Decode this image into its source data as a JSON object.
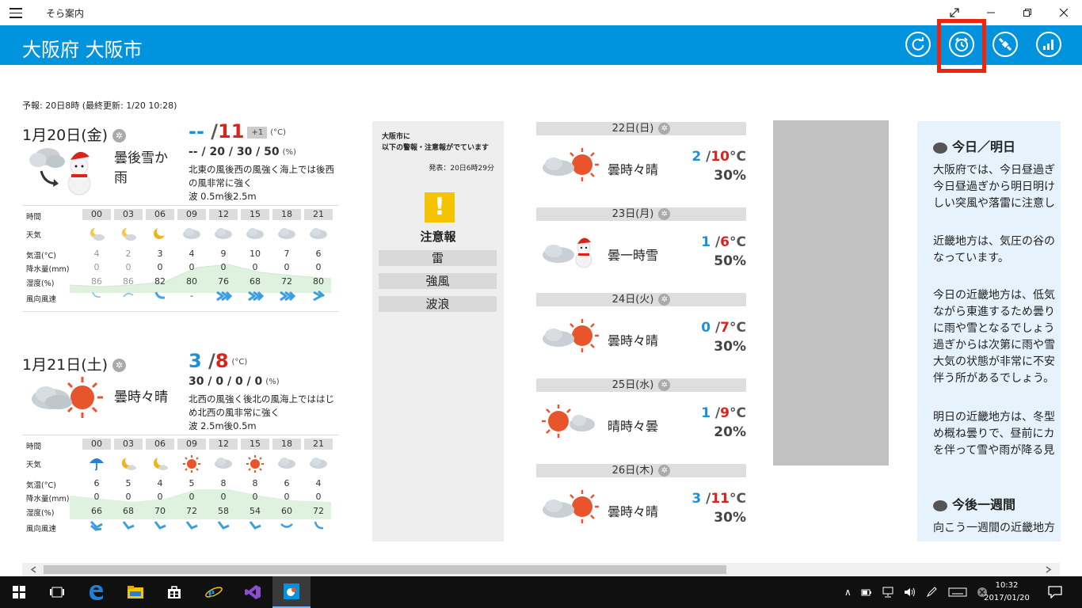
{
  "window": {
    "title": "そら案内"
  },
  "header": {
    "location": "大阪府 大阪市"
  },
  "forecast_note": "予報: 20日8時 (最終更新: 1/20 10:28)",
  "today": {
    "date": "1月20日(金)",
    "low": "--",
    "high": "11",
    "diff": "+1",
    "unit": "(°C)",
    "weather": "曇後雪か雨",
    "precip": "-- / 20 / 30 / 50",
    "precip_unit": "(%)",
    "wind": "北東の風後西の風強く海上では後西の風非常に強く",
    "wave": "波 0.5m後2.5m",
    "hourly": {
      "labels": [
        "時間",
        "天気",
        "気温(°C)",
        "降水量(mm)",
        "湿度(%)",
        "風向風速"
      ],
      "times": [
        "00",
        "03",
        "06",
        "09",
        "12",
        "15",
        "18",
        "21"
      ],
      "icons": [
        "moon-cloud",
        "moon-cloud",
        "moon",
        "cloud",
        "cloud",
        "cloud",
        "cloud",
        "cloud"
      ],
      "temps": [
        "4",
        "2",
        "3",
        "4",
        "9",
        "10",
        "7",
        "6"
      ],
      "rain": [
        "0",
        "0",
        "0",
        "0",
        "0",
        "0",
        "0",
        "0"
      ],
      "humidity": [
        "86",
        "86",
        "82",
        "80",
        "76",
        "68",
        "72",
        "80"
      ],
      "winds": [
        "wind-weak",
        "wind-weak",
        "wind-weak",
        "-",
        "wind-strong",
        "wind-strong",
        "wind-strong",
        "wind-strong"
      ]
    }
  },
  "tomorrow": {
    "date": "1月21日(土)",
    "low": "3",
    "high": "8",
    "unit": "(°C)",
    "weather": "曇時々晴",
    "precip": "30 / 0 / 0 / 0",
    "precip_unit": "(%)",
    "wind": "北西の風強く後北の風海上でははじめ北西の風非常に強く",
    "wave": "波 2.5m後0.5m",
    "hourly": {
      "labels": [
        "時間",
        "天気",
        "気温(°C)",
        "降水量(mm)",
        "湿度(%)",
        "風向風速"
      ],
      "times": [
        "00",
        "03",
        "06",
        "09",
        "12",
        "15",
        "18",
        "21"
      ],
      "icons": [
        "umbrella",
        "moon-cloud",
        "moon-cloud",
        "sun",
        "cloud",
        "sun",
        "cloud",
        "cloud"
      ],
      "temps": [
        "6",
        "5",
        "4",
        "5",
        "8",
        "8",
        "6",
        "4"
      ],
      "rain": [
        "0",
        "0",
        "0",
        "0",
        "0",
        "0",
        "0",
        "0"
      ],
      "humidity": [
        "66",
        "68",
        "70",
        "72",
        "58",
        "54",
        "60",
        "72"
      ],
      "winds": [
        "wind-strong",
        "wind",
        "wind",
        "wind",
        "wind",
        "wind",
        "wind-weak",
        "wind-weak"
      ]
    }
  },
  "alert": {
    "heading_line1": "大阪市に",
    "heading_line2": "以下の警報・注意報がでています",
    "published": "発表：20日6時29分",
    "level": "注意報",
    "items": [
      "雷",
      "強風",
      "波浪"
    ]
  },
  "weekly": [
    {
      "date": "22日(日)",
      "weather": "曇時々晴",
      "low": "2",
      "high": "10",
      "unit": "°C",
      "pop": "30%",
      "icon": "cloud-sun"
    },
    {
      "date": "23日(月)",
      "weather": "曇一時雪",
      "low": "1",
      "high": "6",
      "unit": "°C",
      "pop": "50%",
      "icon": "cloud-snow"
    },
    {
      "date": "24日(火)",
      "weather": "曇時々晴",
      "low": "0",
      "high": "7",
      "unit": "°C",
      "pop": "30%",
      "icon": "cloud-sun"
    },
    {
      "date": "25日(水)",
      "weather": "晴時々曇",
      "low": "1",
      "high": "9",
      "unit": "°C",
      "pop": "20%",
      "icon": "sun-cloud"
    },
    {
      "date": "26日(木)",
      "weather": "曇時々晴",
      "low": "3",
      "high": "11",
      "unit": "°C",
      "pop": "30%",
      "icon": "cloud-sun"
    }
  ],
  "commentary": {
    "heading1": "今日／明日",
    "p1": "大阪府では、今日昼過ぎ\n今日昼過ぎから明日明け\nしい突風や落雷に注意し",
    "p2": "近畿地方は、気圧の谷の\nなっています。",
    "p3": "今日の近畿地方は、低気\nながら東進するため曇り\nに雨や雪となるでしょう\n過ぎからは次第に雨や雪\n大気の状態が非常に不安\n伴う所があるでしょう。",
    "p4": "明日の近畿地方は、冬型\nめ概ね曇りで、昼前にカ\nを伴って雪や雨が降る見",
    "heading2": "今後一週間",
    "p5": "向こう一週間の近畿地方"
  },
  "taskbar": {
    "time": "10:32",
    "date": "2017/01/20"
  }
}
